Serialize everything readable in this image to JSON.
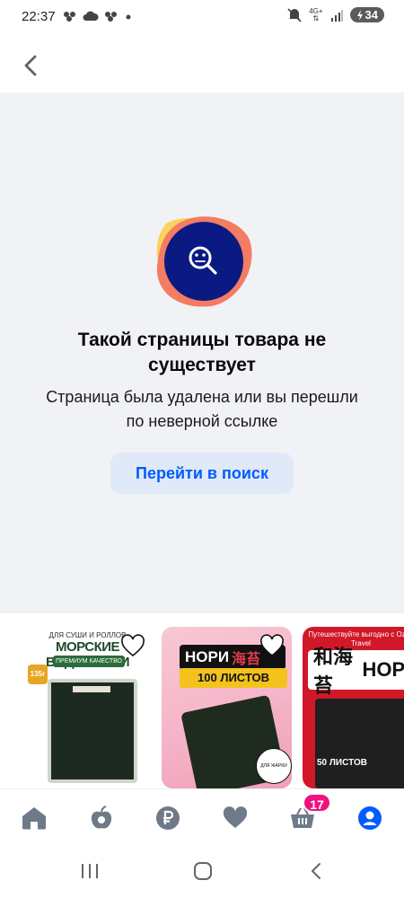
{
  "status_bar": {
    "time": "22:37",
    "network": "4G+",
    "battery": "34",
    "icons": [
      "notification-dots-icon",
      "cloud-icon",
      "notification-dots-icon",
      "dot-icon",
      "mute-icon",
      "signal-icon",
      "battery-charging-icon"
    ]
  },
  "top_bar": {
    "back_icon": "chevron-left-icon"
  },
  "error": {
    "title": "Такой страницы товара не существует",
    "subtitle": "Страница была удалена или вы перешли по неверной ссылке",
    "button_label": "Перейти в поиск",
    "icon": "search-face-icon",
    "colors": {
      "accent": "#005bff",
      "illustration_dark": "#0b1a82",
      "illustration_orange": "#f47c62",
      "illustration_yellow": "#fbd25a",
      "button_bg": "#dfe9f8"
    }
  },
  "products": [
    {
      "top_text": "ДЛЯ СУШИ И РОЛЛОВ",
      "title": "МОРСКИЕ ВОДОРОСЛИ",
      "subtitle": "ПРЕМИУМ КАЧЕСТВО",
      "weight": "135г"
    },
    {
      "title": "НОРИ",
      "title_kanji": "海苔",
      "count_label": "100 ЛИСТОВ",
      "badge_text": "ДЛЯ ЖАРКИ"
    },
    {
      "top_text": "Путешествуйте выгодно с Ozon Travel",
      "title": "НОРИ",
      "title_prefix": "和海苔",
      "count_label": "50 ЛИСТОВ"
    }
  ],
  "bottom_nav": {
    "items": [
      {
        "name": "home",
        "icon": "home-icon"
      },
      {
        "name": "fresh",
        "icon": "apple-icon"
      },
      {
        "name": "finance",
        "icon": "ruble-icon"
      },
      {
        "name": "favorites",
        "icon": "heart-icon"
      },
      {
        "name": "cart",
        "icon": "cart-icon",
        "badge": "17"
      },
      {
        "name": "profile",
        "icon": "profile-icon"
      }
    ],
    "badge_color": "#f1117e",
    "active_color": "#005bff"
  },
  "system_nav": {
    "icons": [
      "recents-icon",
      "home-circle-icon",
      "back-icon"
    ]
  }
}
